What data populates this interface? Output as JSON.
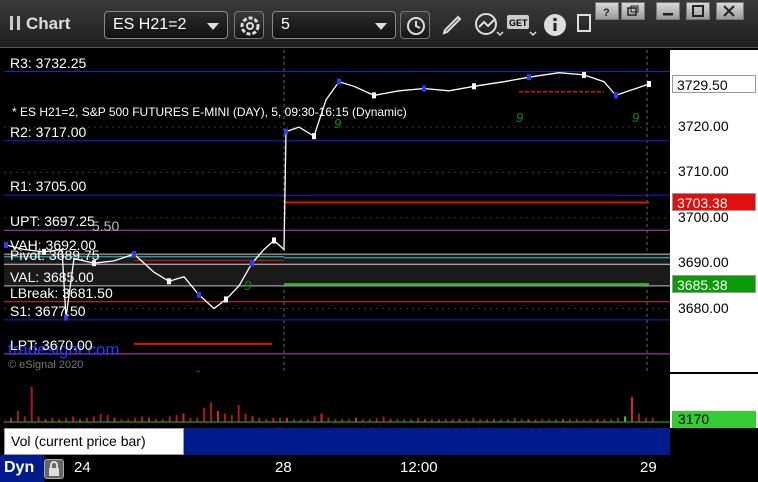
{
  "app": {
    "title": "Chart"
  },
  "toolbar": {
    "symbol": "ES H21=2",
    "interval": "5"
  },
  "window": {
    "buttons": [
      "help",
      "restore-down",
      "minimize",
      "maximize",
      "close"
    ]
  },
  "chart": {
    "header": "* ES H21=2, S&P 500 FUTURES E-MINI (DAY), 5, 09:30-16:15 (Dynamic)",
    "watermark": "tradesight.com",
    "copyright": "© eSignal 2020",
    "levels": [
      {
        "key": "r3",
        "label": "R3: 3732.25",
        "value": 3732.25,
        "color": "#1d1dd6"
      },
      {
        "key": "r2",
        "label": "R2: 3717.00",
        "value": 3717.0,
        "color": "#1d1dd6"
      },
      {
        "key": "r1",
        "label": "R1: 3705.00",
        "value": 3705.0,
        "color": "#1d1dd6"
      },
      {
        "key": "upt",
        "label": "UPT: 3697.25",
        "value": 3697.25,
        "color": "#c040c0"
      },
      {
        "key": "vah",
        "label": "VAH: 3692.00",
        "value": 3692.0,
        "color": "#c0c0c0"
      },
      {
        "key": "pivot",
        "label": "Pivot: 3689.75",
        "value": 3689.75,
        "color": "#d2d2d2"
      },
      {
        "key": "val",
        "label": "VAL: 3685.00",
        "value": 3685.0,
        "color": "#c0c0c0"
      },
      {
        "key": "lbreak",
        "label": "LBreak: 3681.50",
        "value": 3681.5,
        "color": "#e03030"
      },
      {
        "key": "s1",
        "label": "S1: 3677.50",
        "value": 3677.5,
        "color": "#1d1dd6"
      },
      {
        "key": "lpt",
        "label": "LPT: 3670.00",
        "value": 3670.0,
        "color": "#c040c0"
      }
    ],
    "partial_label": "5.50",
    "y_ticks": [
      "3720.00",
      "3710.00",
      "3700.00",
      "3690.00",
      "3680.00"
    ],
    "price_tags": [
      {
        "label": "3729.50",
        "bg": "#ffffff",
        "fg": "#000000"
      },
      {
        "label": "3703.38",
        "bg": "#e01010",
        "fg": "#ffffff"
      },
      {
        "label": "3685.38",
        "bg": "#0a9a0a",
        "fg": "#ffffff"
      }
    ],
    "x_labels": [
      "24",
      "28",
      "12:00",
      "29"
    ]
  },
  "volume": {
    "study_label": "Vol (current price bar)",
    "close_symbol": "×",
    "last_value": "3170",
    "last_value_bg": "#33cc33"
  },
  "footer": {
    "dyn": "Dyn"
  }
}
